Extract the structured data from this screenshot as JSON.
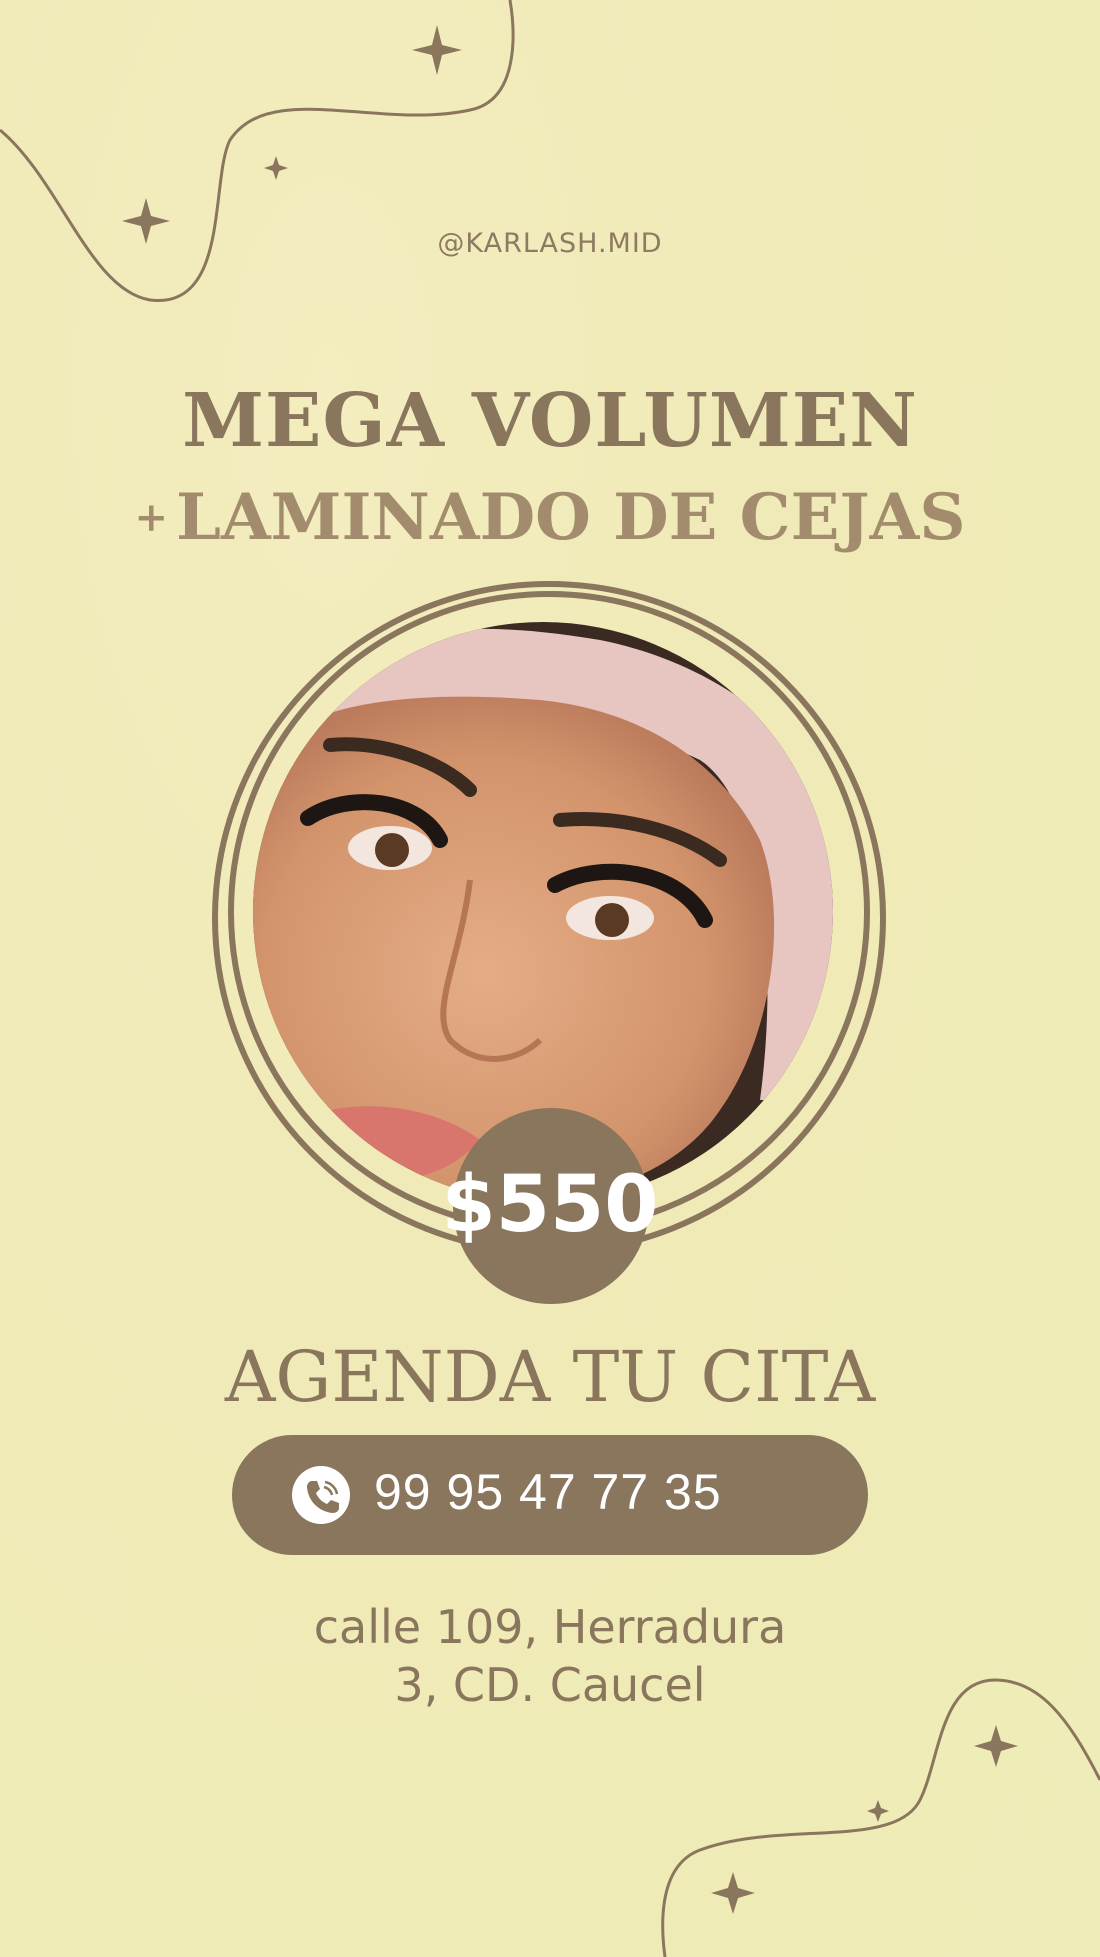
{
  "handle": "@KARLASH.MID",
  "headline": {
    "line1": "MEGA VOLUMEN",
    "plus": "+",
    "line2": "LAMINADO DE CEJAS"
  },
  "price": "$550",
  "cta": "AGENDA TU CITA",
  "phone": {
    "number": "99 95 47 77 35",
    "icon": "phone-icon"
  },
  "address": {
    "line1": "calle 109, Herradura",
    "line2": "3, CD. Caucel"
  },
  "colors": {
    "background": "#f0eab8",
    "accent": "#8a755d",
    "accent_light": "#a38c6e",
    "text_on_accent": "#ffffff"
  }
}
